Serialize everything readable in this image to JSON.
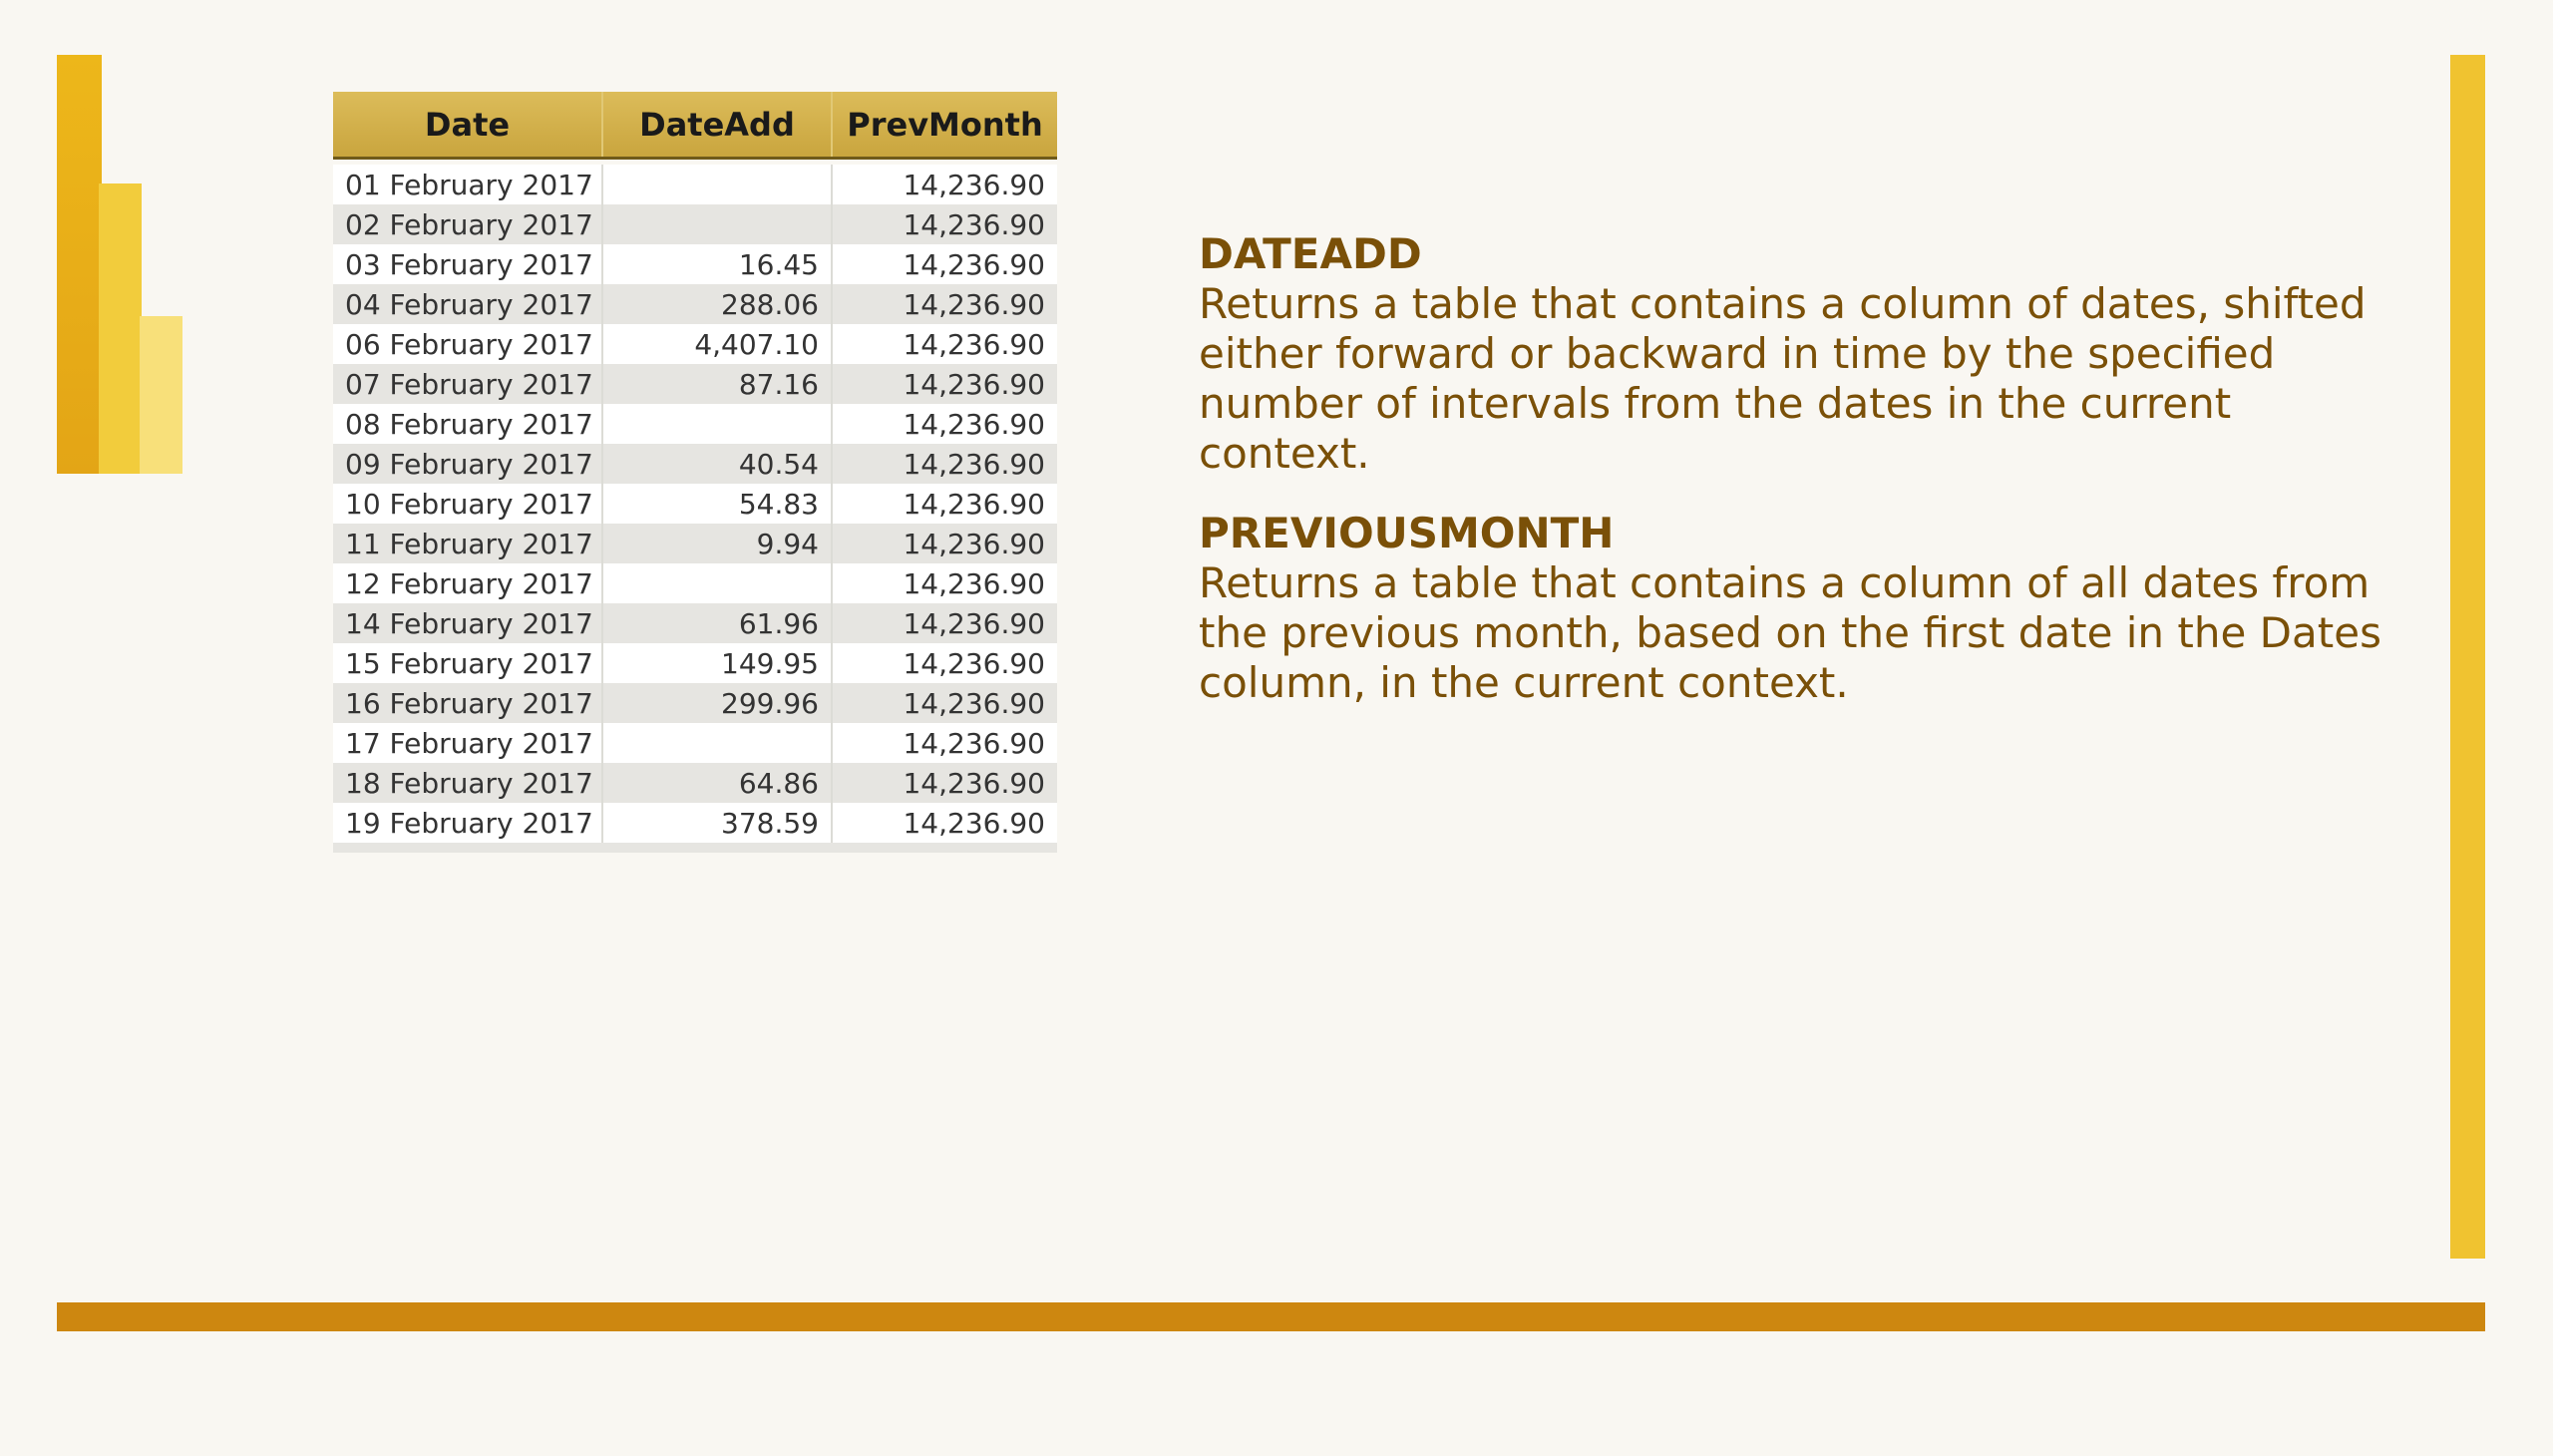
{
  "table": {
    "columns": [
      "Date",
      "DateAdd",
      "PrevMonth"
    ],
    "rows": [
      {
        "date": "01 February 2017",
        "dateadd": "",
        "prevmonth": "14,236.90"
      },
      {
        "date": "02 February 2017",
        "dateadd": "",
        "prevmonth": "14,236.90"
      },
      {
        "date": "03 February 2017",
        "dateadd": "16.45",
        "prevmonth": "14,236.90"
      },
      {
        "date": "04 February 2017",
        "dateadd": "288.06",
        "prevmonth": "14,236.90"
      },
      {
        "date": "06 February 2017",
        "dateadd": "4,407.10",
        "prevmonth": "14,236.90"
      },
      {
        "date": "07 February 2017",
        "dateadd": "87.16",
        "prevmonth": "14,236.90"
      },
      {
        "date": "08 February 2017",
        "dateadd": "",
        "prevmonth": "14,236.90"
      },
      {
        "date": "09 February 2017",
        "dateadd": "40.54",
        "prevmonth": "14,236.90"
      },
      {
        "date": "10 February 2017",
        "dateadd": "54.83",
        "prevmonth": "14,236.90"
      },
      {
        "date": "11 February 2017",
        "dateadd": "9.94",
        "prevmonth": "14,236.90"
      },
      {
        "date": "12 February 2017",
        "dateadd": "",
        "prevmonth": "14,236.90"
      },
      {
        "date": "14 February 2017",
        "dateadd": "61.96",
        "prevmonth": "14,236.90"
      },
      {
        "date": "15 February 2017",
        "dateadd": "149.95",
        "prevmonth": "14,236.90"
      },
      {
        "date": "16 February 2017",
        "dateadd": "299.96",
        "prevmonth": "14,236.90"
      },
      {
        "date": "17 February 2017",
        "dateadd": "",
        "prevmonth": "14,236.90"
      },
      {
        "date": "18 February 2017",
        "dateadd": "64.86",
        "prevmonth": "14,236.90"
      },
      {
        "date": "19 February 2017",
        "dateadd": "378.59",
        "prevmonth": "14,236.90"
      }
    ]
  },
  "sections": [
    {
      "heading": "DATEADD",
      "body": "Returns a table that contains a column of dates, shifted either forward or backward in time by the specified number of intervals from the dates in the current context."
    },
    {
      "heading": "PREVIOUSMONTH",
      "body": "Returns a table that contains a column of all dates from the previous month, based on the first date in the Dates column, in the current context."
    }
  ],
  "colors": {
    "background": "#f9f7f2",
    "header_gold": "#d4b24c",
    "text_brown": "#7a5008",
    "accent_yellow": "#f0c330",
    "bottom_rule": "#cd8710"
  }
}
